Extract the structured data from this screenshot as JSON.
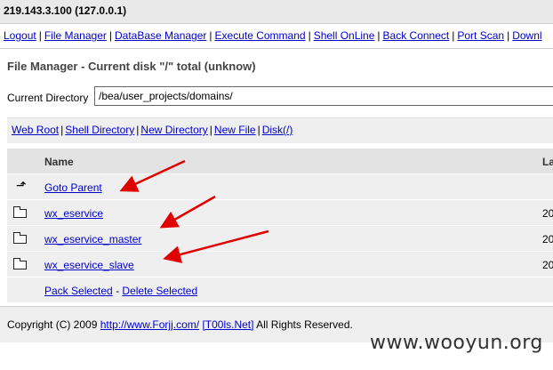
{
  "topbar": {
    "title": "219.143.3.100 (127.0.0.1)"
  },
  "menu": [
    {
      "label": "Logout"
    },
    {
      "label": "File Manager"
    },
    {
      "label": "DataBase Manager"
    },
    {
      "label": "Execute Command"
    },
    {
      "label": "Shell OnLine"
    },
    {
      "label": "Back Connect"
    },
    {
      "label": "Port Scan"
    },
    {
      "label": "Downl"
    }
  ],
  "page": {
    "title": "File Manager - Current disk \"/\" total (unknow)"
  },
  "current_directory": {
    "label": "Current Directory",
    "value": "/bea/user_projects/domains/"
  },
  "toolbox": [
    {
      "label": "Web Root"
    },
    {
      "label": "Shell Directory"
    },
    {
      "label": "New Directory"
    },
    {
      "label": "New File"
    },
    {
      "label": "Disk(/)"
    }
  ],
  "table": {
    "headers": {
      "name": "Name",
      "date": "La"
    },
    "parent": {
      "label": "Goto Parent"
    },
    "rows": [
      {
        "name": "wx_eservice",
        "date": "20"
      },
      {
        "name": "wx_eservice_master",
        "date": "20"
      },
      {
        "name": "wx_eservice_slave",
        "date": "20"
      }
    ],
    "actions": {
      "pack": "Pack Selected",
      "separator": "-",
      "delete": "Delete Selected"
    }
  },
  "footer": {
    "copyright": "Copyright (C) 2009",
    "link1": "http://www.Forjj.com/",
    "link2": "[T00ls.Net]",
    "rights": "All Rights Reserved."
  },
  "watermark": "www.wooyun.org",
  "colors": {
    "link": "#0000cc",
    "annotation_arrow": "#e00000",
    "row_bg": "#efefef"
  }
}
